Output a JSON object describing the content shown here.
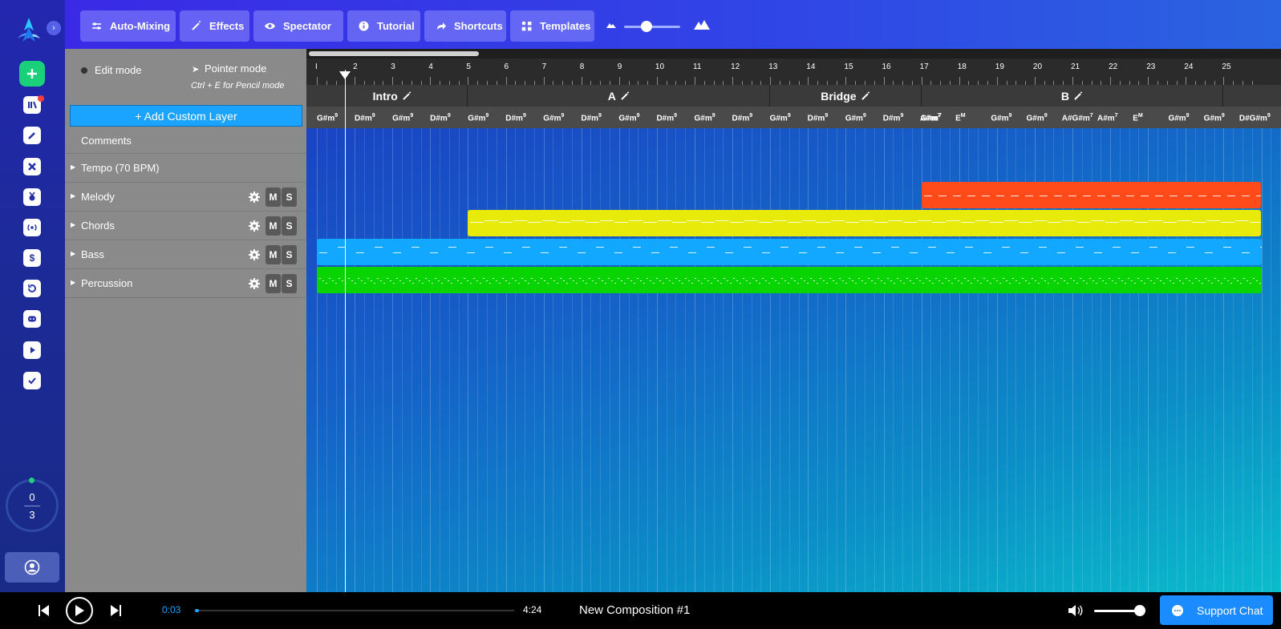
{
  "toolbar": {
    "buttons": [
      {
        "id": "auto-mixing",
        "label": "Auto-Mixing",
        "icon": "sliders-icon"
      },
      {
        "id": "effects",
        "label": "Effects",
        "icon": "wand-icon"
      },
      {
        "id": "spectator",
        "label": "Spectator",
        "icon": "eye-icon"
      },
      {
        "id": "tutorial",
        "label": "Tutorial",
        "icon": "info-icon"
      },
      {
        "id": "shortcuts",
        "label": "Shortcuts",
        "icon": "share-arrow-icon"
      },
      {
        "id": "templates",
        "label": "Templates",
        "icon": "grid-icon"
      }
    ],
    "zoom_level": 0.3
  },
  "rail": {
    "counter_top": "0",
    "counter_bottom": "3",
    "icons": [
      "add-icon",
      "layers-icon",
      "pencil-icon",
      "tools-icon",
      "medal-icon",
      "broadcast-icon",
      "dollar-icon",
      "history-icon",
      "discord-icon",
      "play-icon",
      "download-icon",
      "user-icon"
    ]
  },
  "panel": {
    "edit_mode": "Edit mode",
    "pointer_mode": "Pointer mode",
    "pencil_hint": "Ctrl + E for Pencil mode",
    "add_layer": "+ Add Custom Layer",
    "comments": "Comments",
    "tempo": "Tempo (70 BPM)",
    "layers": [
      {
        "name": "Melody",
        "mute": "M",
        "solo": "S"
      },
      {
        "name": "Chords",
        "mute": "M",
        "solo": "S"
      },
      {
        "name": "Bass",
        "mute": "M",
        "solo": "S"
      },
      {
        "name": "Percussion",
        "mute": "M",
        "solo": "S"
      }
    ]
  },
  "timeline": {
    "bars": [
      "I",
      "2",
      "3",
      "4",
      "5",
      "6",
      "7",
      "8",
      "9",
      "10",
      "11",
      "12",
      "13",
      "14",
      "15",
      "16",
      "17",
      "18",
      "19",
      "20",
      "21",
      "22",
      "23",
      "24",
      "25"
    ],
    "sections": [
      {
        "label": "Intro",
        "start": 1,
        "end": 5
      },
      {
        "label": "A",
        "start": 5,
        "end": 13
      },
      {
        "label": "Bridge",
        "start": 13,
        "end": 17
      },
      {
        "label": "B",
        "start": 17,
        "end": 25
      }
    ],
    "chords": [
      {
        "root": "G#m",
        "ext": "9"
      },
      {
        "root": "D#m",
        "ext": "9"
      },
      {
        "root": "G#m",
        "ext": "9"
      },
      {
        "root": "D#m",
        "ext": "9"
      },
      {
        "root": "G#m",
        "ext": "9"
      },
      {
        "root": "D#m",
        "ext": "9"
      },
      {
        "root": "G#m",
        "ext": "9"
      },
      {
        "root": "D#m",
        "ext": "9"
      },
      {
        "root": "G#m",
        "ext": "9"
      },
      {
        "root": "D#m",
        "ext": "9"
      },
      {
        "root": "G#m",
        "ext": "9"
      },
      {
        "root": "D#m",
        "ext": "9"
      },
      {
        "root": "G#m",
        "ext": "9"
      },
      {
        "root": "D#m",
        "ext": "9"
      },
      {
        "root": "G#m",
        "ext": "9"
      },
      {
        "root": "D#m",
        "ext": "9"
      },
      {
        "root": "G#m",
        "ext": "7"
      },
      {
        "root": "A#m",
        "ext": "7"
      },
      {
        "root": "E",
        "ext": "M"
      },
      {
        "root": "G#m",
        "ext": "9"
      },
      {
        "root": "G#m",
        "ext": "9"
      },
      {
        "root": "A#G#m",
        "ext": "7"
      },
      {
        "root": "A#m",
        "ext": "7"
      },
      {
        "root": "E",
        "ext": "M"
      },
      {
        "root": "G#m",
        "ext": "9"
      },
      {
        "root": "G#m",
        "ext": "9"
      },
      {
        "root": "D#G#m",
        "ext": "9"
      }
    ],
    "clips": [
      {
        "layer": "Melody",
        "start": 17,
        "end": 26,
        "color": "#ff4a1a"
      },
      {
        "layer": "Chords",
        "start": 5,
        "end": 26,
        "color": "#e8ea0a"
      },
      {
        "layer": "Bass",
        "start": 1,
        "end": 26,
        "color": "#12a8ff"
      },
      {
        "layer": "Percussion",
        "start": 1,
        "end": 26,
        "color": "#07d400"
      }
    ],
    "playhead_bar": 1.75
  },
  "transport": {
    "current_time": "0:03",
    "total_time": "4:24",
    "progress": 0.012,
    "title": "New Composition #1",
    "volume": 0.9,
    "support_label": "Support Chat"
  }
}
